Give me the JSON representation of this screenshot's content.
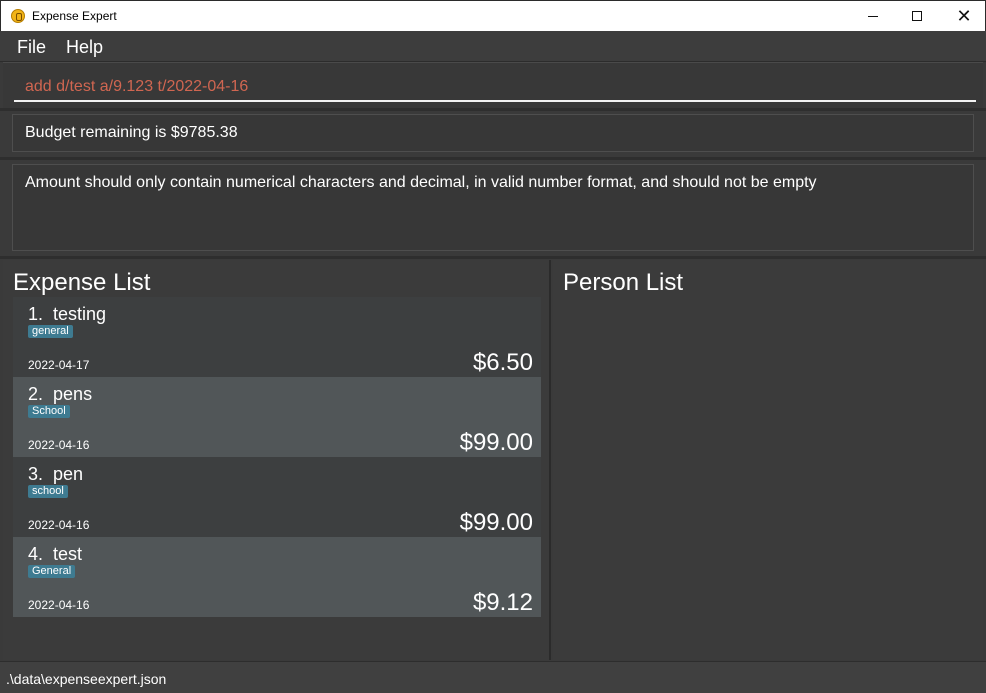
{
  "window": {
    "title": "Expense Expert",
    "controls": {
      "minimize": "—",
      "maximize": "□",
      "close": "✕"
    }
  },
  "menu": {
    "file": "File",
    "help": "Help"
  },
  "command": {
    "value": "add d/test a/9.123 t/2022-04-16",
    "color": "#d06651"
  },
  "budget": {
    "text": "Budget remaining is $9785.38"
  },
  "result": {
    "text": "Amount should only contain numerical characters and decimal, in valid number format, and should not be empty"
  },
  "expense_list": {
    "title": "Expense List",
    "items": [
      {
        "index": "1.",
        "name": "testing",
        "tag": "general",
        "date": "2022-04-17",
        "amount": "$6.50"
      },
      {
        "index": "2.",
        "name": "pens",
        "tag": "School",
        "date": "2022-04-16",
        "amount": "$99.00"
      },
      {
        "index": "3.",
        "name": "pen",
        "tag": "school",
        "date": "2022-04-16",
        "amount": "$99.00"
      },
      {
        "index": "4.",
        "name": "test",
        "tag": "General",
        "date": "2022-04-16",
        "amount": "$9.12"
      }
    ]
  },
  "person_list": {
    "title": "Person List"
  },
  "status": {
    "file_path": ".\\data\\expenseexpert.json"
  },
  "colors": {
    "tag": "#3e7b91",
    "row_alt": "#515658",
    "background": "#3a3a3a"
  },
  "icons": {
    "app": "coin-icon"
  }
}
